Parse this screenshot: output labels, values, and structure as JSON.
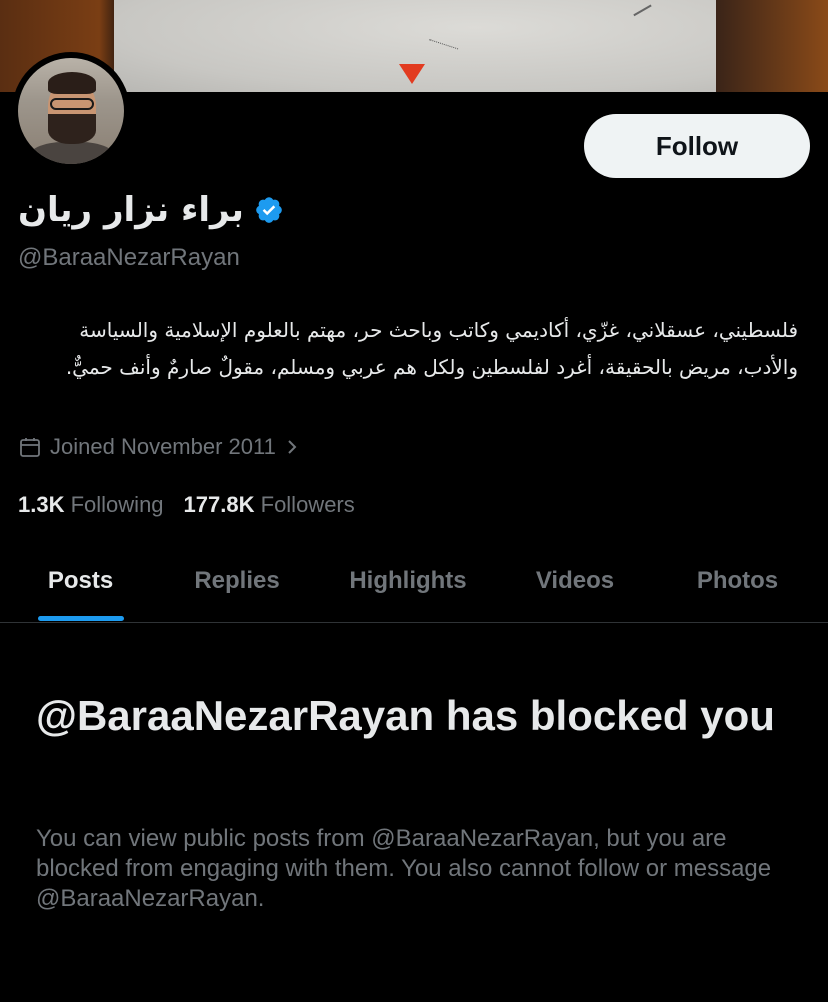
{
  "profile": {
    "display_name": "براء نزار ريان",
    "handle": "@BaraaNezarRayan",
    "verified": true,
    "bio": "فلسطيني، عسقلاني، غزّي، أكاديمي وكاتب وباحث حر، مهتم بالعلوم الإسلامية والسياسة والأدب، مريض بالحقيقة، أغرد لفلسطين ولكل هم عربي ومسلم، مقولٌ صارمٌ وأنف حميٌّ.",
    "joined": "Joined November 2011",
    "following_count": "1.3K",
    "following_label": "Following",
    "followers_count": "177.8K",
    "followers_label": "Followers",
    "follow_button": "Follow"
  },
  "tabs": [
    {
      "label": "Posts",
      "active": true
    },
    {
      "label": "Replies",
      "active": false
    },
    {
      "label": "Highlights",
      "active": false
    },
    {
      "label": "Videos",
      "active": false
    },
    {
      "label": "Photos",
      "active": false
    }
  ],
  "blocked": {
    "title": "@BaraaNezarRayan has blocked you",
    "message": "You can view public posts from @BaraaNezarRayan, but you are blocked from engaging with them. You also cannot follow or message @BaraaNezarRayan."
  },
  "colors": {
    "background": "#000000",
    "accent": "#1d9bf0",
    "secondary_text": "#71767b",
    "primary_text": "#e7e9ea"
  },
  "icons": {
    "verified": "verified-badge-icon",
    "calendar": "calendar-icon",
    "chevron": "chevron-right-icon"
  }
}
